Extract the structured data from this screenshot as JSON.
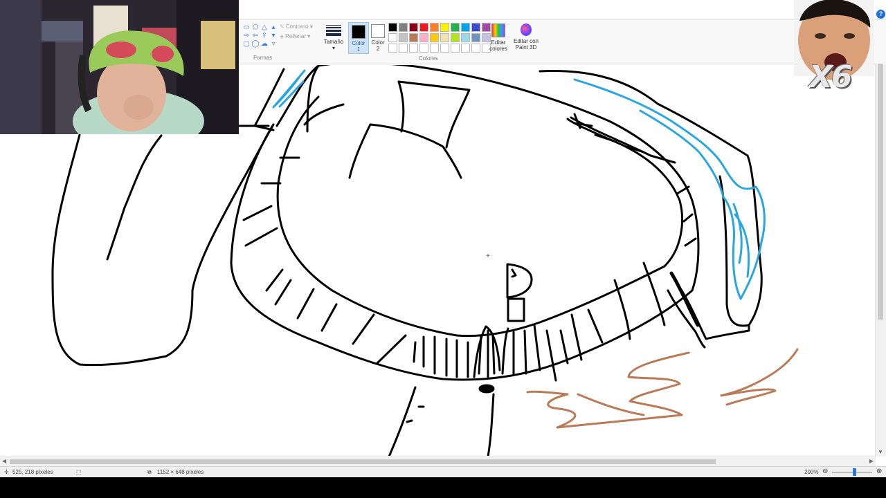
{
  "ribbon": {
    "shapes_group": {
      "label": "Formas",
      "outline_label": "Contorno",
      "fill_label": "Rellenar"
    },
    "size_label": "Tamaño",
    "color1_label": "Color\n1",
    "color2_label": "Color\n2",
    "colors_group_label": "Colores",
    "edit_colors_label": "Editar\ncolores",
    "paint3d_label": "Editar con\nPaint 3D",
    "color1": "#000000",
    "color2": "#ffffff",
    "palette": [
      "#000000",
      "#7f7f7f",
      "#880015",
      "#ed1c24",
      "#ff7f27",
      "#fff200",
      "#22b14c",
      "#00a2e8",
      "#3f48cc",
      "#a349a4",
      "#ffffff",
      "#c3c3c3",
      "#b97a57",
      "#ffaec9",
      "#ffc90e",
      "#efe4b0",
      "#b5e61d",
      "#99d9ea",
      "#7092be",
      "#c8bfe7",
      "#ffffff",
      "#ffffff",
      "#ffffff",
      "#ffffff",
      "#ffffff",
      "#ffffff",
      "#ffffff",
      "#ffffff",
      "#ffffff",
      "#ffffff"
    ]
  },
  "statusbar": {
    "cursor_position": "525, 218 píxeles",
    "image_size": "1152 × 648 píxeles",
    "zoom": "200%"
  },
  "overlay": {
    "reaction_badge": "X6"
  },
  "colors": {
    "ink": "#000000",
    "water": "#29a6e0",
    "dirt": "#b97a57",
    "accent": "#2b78d4"
  }
}
